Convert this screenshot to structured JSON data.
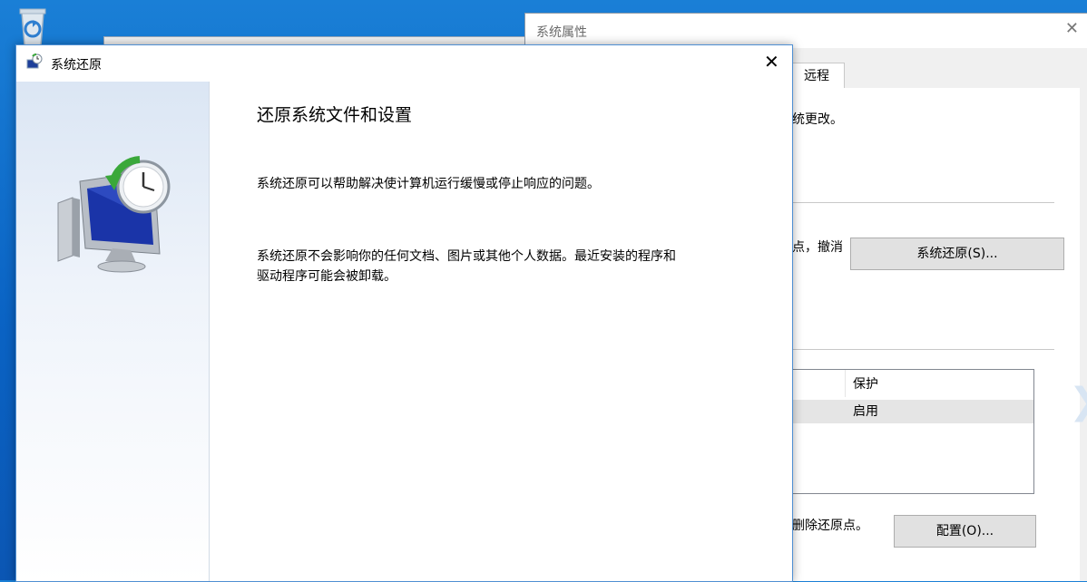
{
  "wizard": {
    "title": "系统还原",
    "heading": "还原系统文件和设置",
    "paragraph1": "系统还原可以帮助解决使计算机运行缓慢或停止响应的问题。",
    "paragraph2_line1": "系统还原不会影响你的任何文档、图片或其他个人数据。最近安装的程序和",
    "paragraph2_line2": "驱动程序可能会被卸载。",
    "close_glyph": "✕"
  },
  "system_properties": {
    "title": "系统属性",
    "close_glyph": "✕",
    "tab_remote": "远程",
    "text_changes": "统更改。",
    "text_undo": "点，撤消",
    "system_restore_button": "系统还原(S)...",
    "list_header_protect": "保护",
    "list_value_enabled": "启用",
    "text_delete": "删除还原点。",
    "configure_button": "配置(O)..."
  },
  "colors": {
    "desktop_blue": "#0a63c4",
    "accent_border": "#4f8fd3"
  }
}
